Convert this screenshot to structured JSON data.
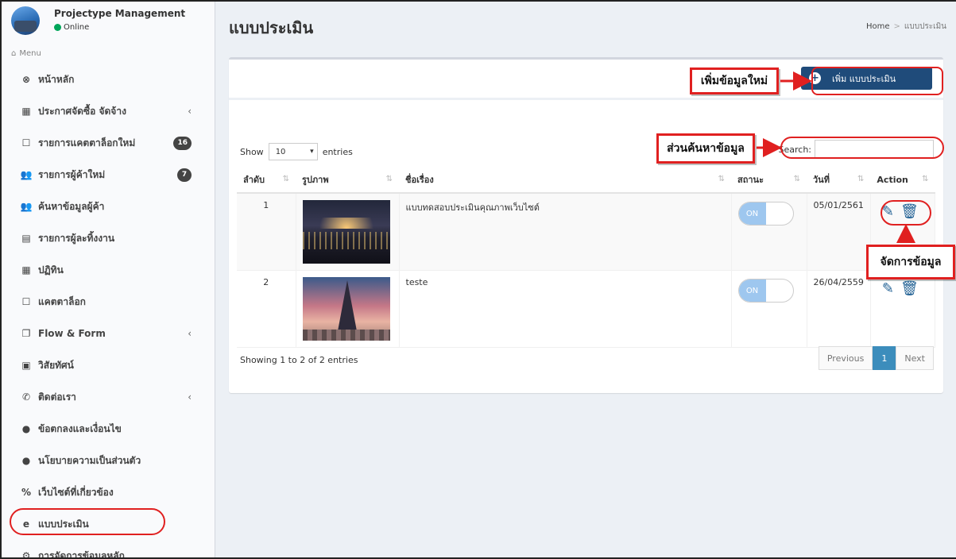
{
  "sidebar": {
    "user_name": "Projectype Management",
    "user_status": "Online",
    "menu_header": "Menu",
    "items": [
      {
        "label": "หน้าหลัก",
        "icon": "link-icon",
        "glyph": "⊗"
      },
      {
        "label": "ประกาศจัดซื้อ จัดจ้าง",
        "icon": "newspaper-icon",
        "glyph": "▦",
        "chevron": true
      },
      {
        "label": "รายการแคตตาล็อกใหม่",
        "icon": "square-icon",
        "glyph": "☐",
        "badge": "16"
      },
      {
        "label": "รายการผู้ค้าใหม่",
        "icon": "users-icon",
        "glyph": "👥",
        "badge": "7"
      },
      {
        "label": "ค้นหาข้อมูลผู้ค้า",
        "icon": "users-icon",
        "glyph": "👥"
      },
      {
        "label": "รายการผู้ละทิ้งงาน",
        "icon": "file-icon",
        "glyph": "▤"
      },
      {
        "label": "ปฏิทิน",
        "icon": "calendar-icon",
        "glyph": "▦"
      },
      {
        "label": "แคตตาล็อก",
        "icon": "square-icon",
        "glyph": "☐"
      },
      {
        "label": "Flow & Form",
        "icon": "files-icon",
        "glyph": "❐",
        "chevron": true
      },
      {
        "label": "วิสัยทัศน์",
        "icon": "image-icon",
        "glyph": "▣"
      },
      {
        "label": "ติดต่อเรา",
        "icon": "whatsapp-icon",
        "glyph": "✆",
        "chevron": true
      },
      {
        "label": "ข้อตกลงและเงื่อนไข",
        "icon": "info-icon",
        "glyph": "●"
      },
      {
        "label": "นโยบายความเป็นส่วนตัว",
        "icon": "info-icon",
        "glyph": "●"
      },
      {
        "label": "เว็บไซต์ที่เกี่ยวข้อง",
        "icon": "percent-icon",
        "glyph": "%"
      },
      {
        "label": "แบบประเมิน",
        "icon": "internet-explorer-icon",
        "glyph": "e"
      },
      {
        "label": "การจัดการข้อมูลหลัก",
        "icon": "cogs-icon",
        "glyph": "⚙"
      }
    ]
  },
  "header": {
    "title": "แบบประเมิน",
    "breadcrumb_home": "Home",
    "breadcrumb_sep": ">",
    "breadcrumb_current": "แบบประเมิน"
  },
  "toolbar": {
    "add_label": "เพิ่ม แบบประเมิน"
  },
  "table_controls": {
    "show_label": "Show",
    "page_size": "10",
    "entries_label": "entries",
    "search_label": "Search:",
    "search_value": ""
  },
  "table": {
    "columns": [
      "ลำดับ",
      "รูปภาพ",
      "ชื่อเรื่อง",
      "สถานะ",
      "วันที่",
      "Action"
    ],
    "rows": [
      {
        "no": "1",
        "title": "แบบทดสอบประเมินคุณภาพเว็บไซต์",
        "status": "ON",
        "date": "05/01/2561",
        "image": "city-night"
      },
      {
        "no": "2",
        "title": "teste",
        "status": "ON",
        "date": "26/04/2559",
        "image": "eiffel-tower"
      }
    ]
  },
  "footer": {
    "info": "Showing 1 to 2 of 2 entries",
    "prev": "Previous",
    "page": "1",
    "next": "Next"
  },
  "annotations": {
    "add_new": "เพิ่มข้อมูลใหม่",
    "search_area": "ส่วนค้นหาข้อมูล",
    "manage": "จัดการข้อมูล",
    "color": "#e02020"
  },
  "colors": {
    "primary_button": "#1f4b7a",
    "page_active": "#3c8dbc",
    "online": "#00a65a",
    "action_icon": "#1f5f93"
  }
}
